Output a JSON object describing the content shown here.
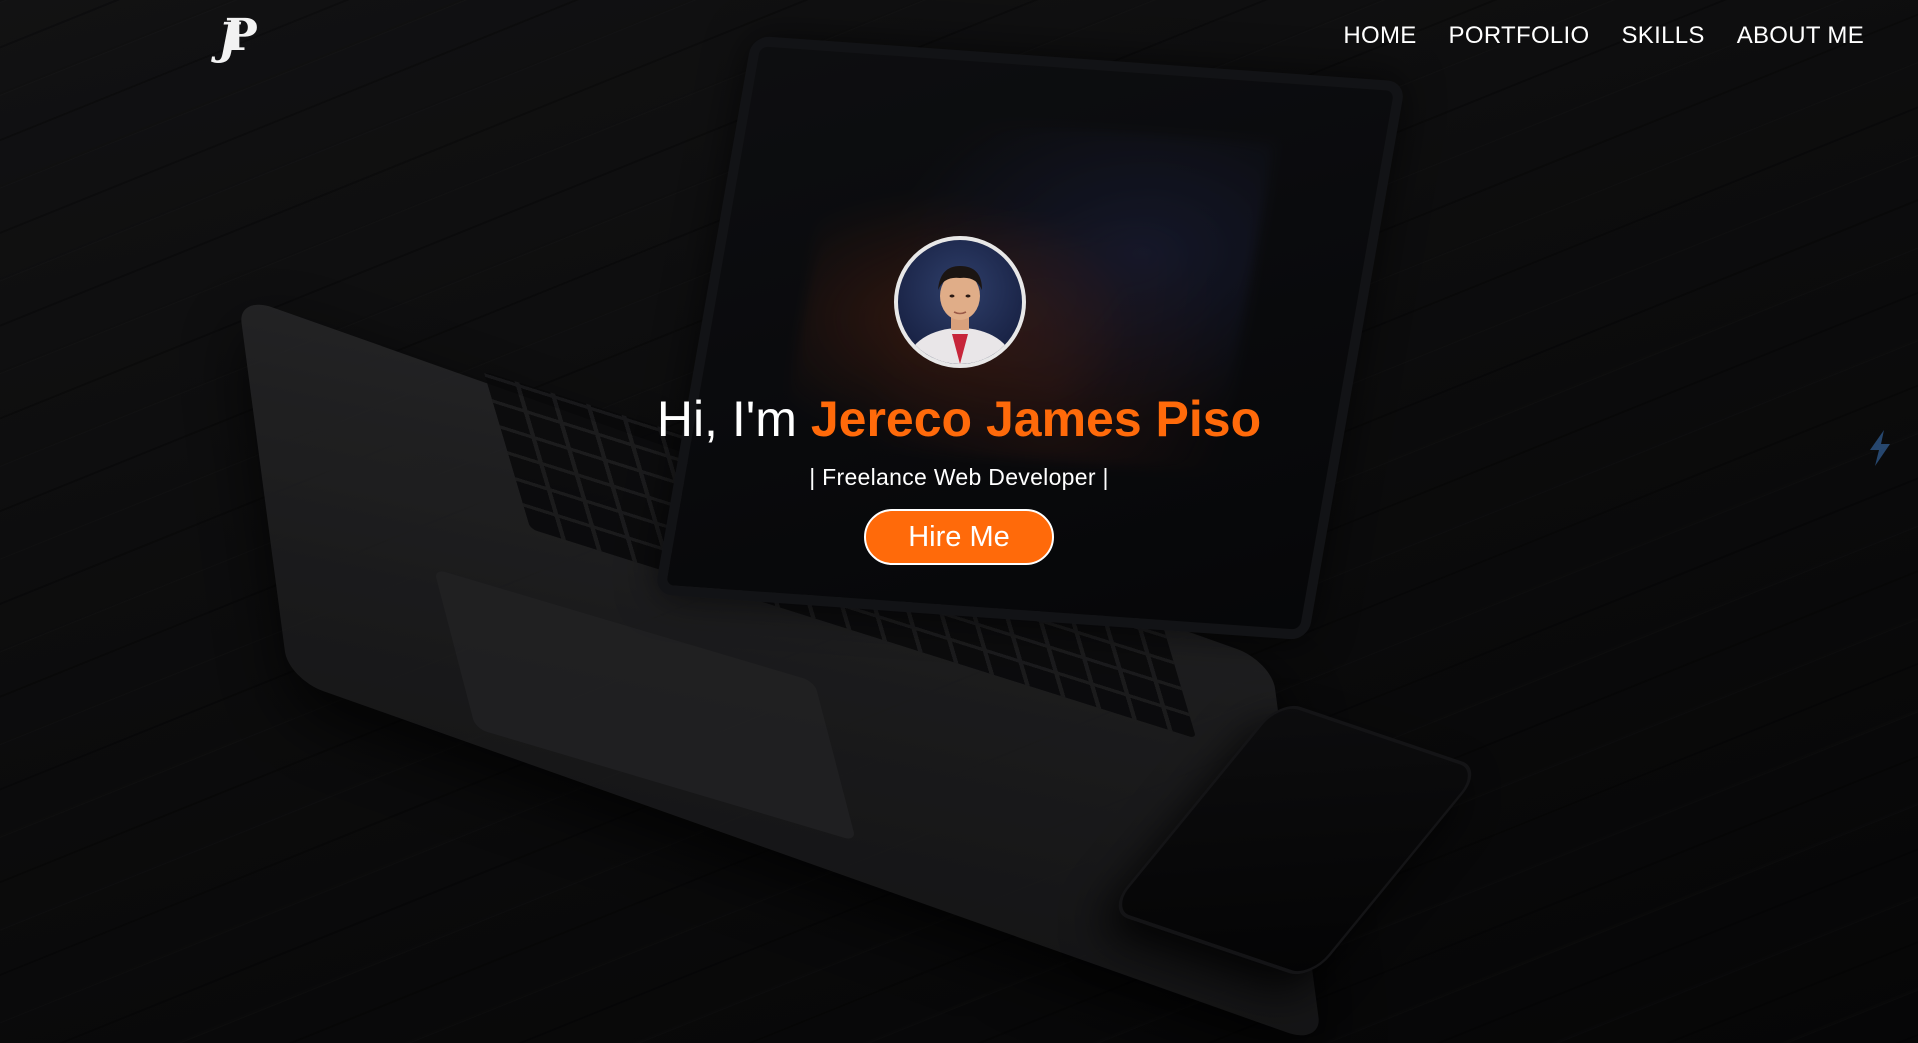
{
  "logo": {
    "j": "J",
    "p": "P"
  },
  "nav": {
    "items": [
      {
        "label": "HOME"
      },
      {
        "label": "PORTFOLIO"
      },
      {
        "label": "SKILLS"
      },
      {
        "label": "ABOUT ME"
      }
    ]
  },
  "hero": {
    "greeting": "Hi, I'm",
    "name": "Jereco James Piso",
    "subtitle": "| Freelance Web Developer |",
    "cta_label": "Hire Me"
  },
  "icons": {
    "avatar": "profile-photo",
    "side": "lightning-icon"
  },
  "colors": {
    "accent": "#ff6a0a",
    "text": "#ffffff",
    "background": "#141415"
  }
}
